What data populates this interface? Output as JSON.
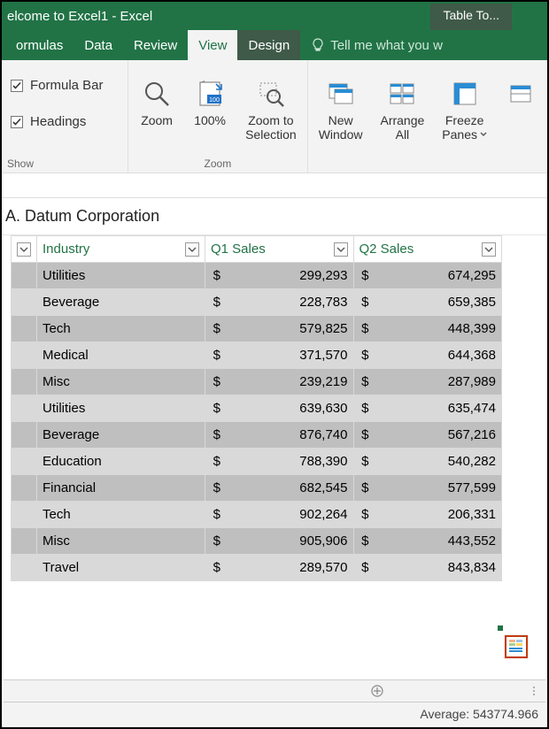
{
  "title": "elcome to Excel1 - Excel",
  "contextTab": "Table To...",
  "tabs": {
    "formulas": "ormulas",
    "data": "Data",
    "review": "Review",
    "view": "View",
    "design": "Design",
    "tellMe": "Tell me what you w"
  },
  "ribbon": {
    "formulaBar": "Formula Bar",
    "headings": "Headings",
    "showGroup": "Show",
    "zoom": "Zoom",
    "hundred": "100%",
    "zoomSelection1": "Zoom to",
    "zoomSelection2": "Selection",
    "zoomGroup": "Zoom",
    "newWindow1": "New",
    "newWindow2": "Window",
    "arrangeAll1": "Arrange",
    "arrangeAll2": "All",
    "freezePanes1": "Freeze",
    "freezePanes2": "Panes"
  },
  "activeCell": "A. Datum Corporation",
  "headers": {
    "industry": "Industry",
    "q1": "Q1 Sales",
    "q2": "Q2 Sales"
  },
  "rows": [
    {
      "industry": "Utilities",
      "q1": "299,293",
      "q2": "674,295"
    },
    {
      "industry": "Beverage",
      "q1": "228,783",
      "q2": "659,385"
    },
    {
      "industry": "Tech",
      "q1": "579,825",
      "q2": "448,399"
    },
    {
      "industry": "Medical",
      "q1": "371,570",
      "q2": "644,368"
    },
    {
      "industry": "Misc",
      "q1": "239,219",
      "q2": "287,989"
    },
    {
      "industry": "Utilities",
      "q1": "639,630",
      "q2": "635,474"
    },
    {
      "industry": "Beverage",
      "q1": "876,740",
      "q2": "567,216"
    },
    {
      "industry": "Education",
      "q1": "788,390",
      "q2": "540,282"
    },
    {
      "industry": "Financial",
      "q1": "682,545",
      "q2": "577,599"
    },
    {
      "industry": "Tech",
      "q1": "902,264",
      "q2": "206,331"
    },
    {
      "industry": "Misc",
      "q1": "905,906",
      "q2": "443,552"
    },
    {
      "industry": "Travel",
      "q1": "289,570",
      "q2": "843,834"
    }
  ],
  "currency": "$",
  "status": {
    "average": "Average: 543774.966"
  },
  "chart_data": {
    "type": "table",
    "title": "A. Datum Corporation",
    "columns": [
      "Industry",
      "Q1 Sales",
      "Q2 Sales"
    ],
    "series": [
      {
        "name": "Q1 Sales",
        "values": [
          299293,
          228783,
          579825,
          371570,
          239219,
          639630,
          876740,
          788390,
          682545,
          902264,
          905906,
          289570
        ]
      },
      {
        "name": "Q2 Sales",
        "values": [
          674295,
          659385,
          448399,
          644368,
          287989,
          635474,
          567216,
          540282,
          577599,
          206331,
          443552,
          843834
        ]
      }
    ],
    "categories": [
      "Utilities",
      "Beverage",
      "Tech",
      "Medical",
      "Misc",
      "Utilities",
      "Beverage",
      "Education",
      "Financial",
      "Tech",
      "Misc",
      "Travel"
    ]
  }
}
